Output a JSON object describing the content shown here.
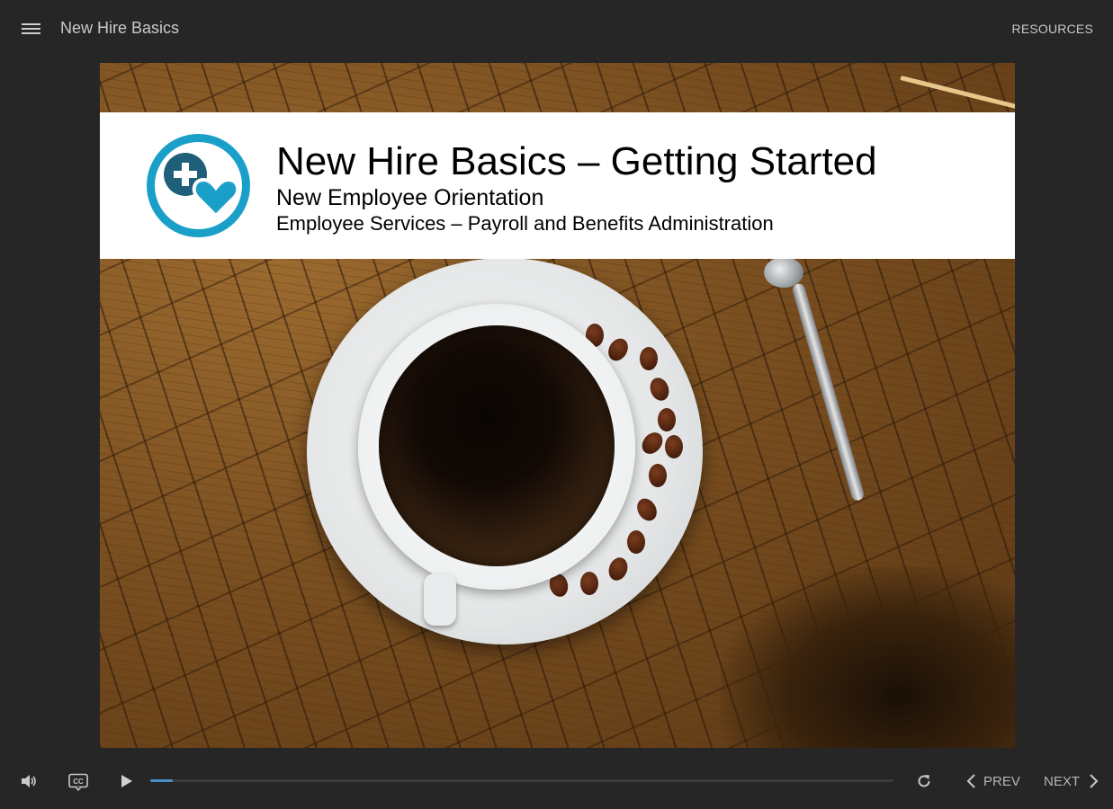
{
  "app": {
    "title": "New Hire Basics",
    "resources_label": "RESOURCES"
  },
  "slide": {
    "title": "New Hire Basics – Getting Started",
    "subtitle": "New Employee Orientation",
    "subtitle2": "Employee Services – Payroll and Benefits Administration"
  },
  "controls": {
    "prev_label": "PREV",
    "next_label": "NEXT",
    "progress": 0.03
  },
  "icons": {
    "menu": "menu-icon",
    "volume": "volume-icon",
    "cc": "closed-captions-icon",
    "play": "play-icon",
    "replay": "replay-icon",
    "prev": "chevron-left-icon",
    "next": "chevron-right-icon",
    "logo": "medical-heart-logo"
  },
  "colors": {
    "background": "#262626",
    "text_light": "#c9c9c9",
    "accent": "#4a90c8",
    "logo_teal": "#1aa0c8",
    "logo_dark": "#1f5f7a"
  }
}
